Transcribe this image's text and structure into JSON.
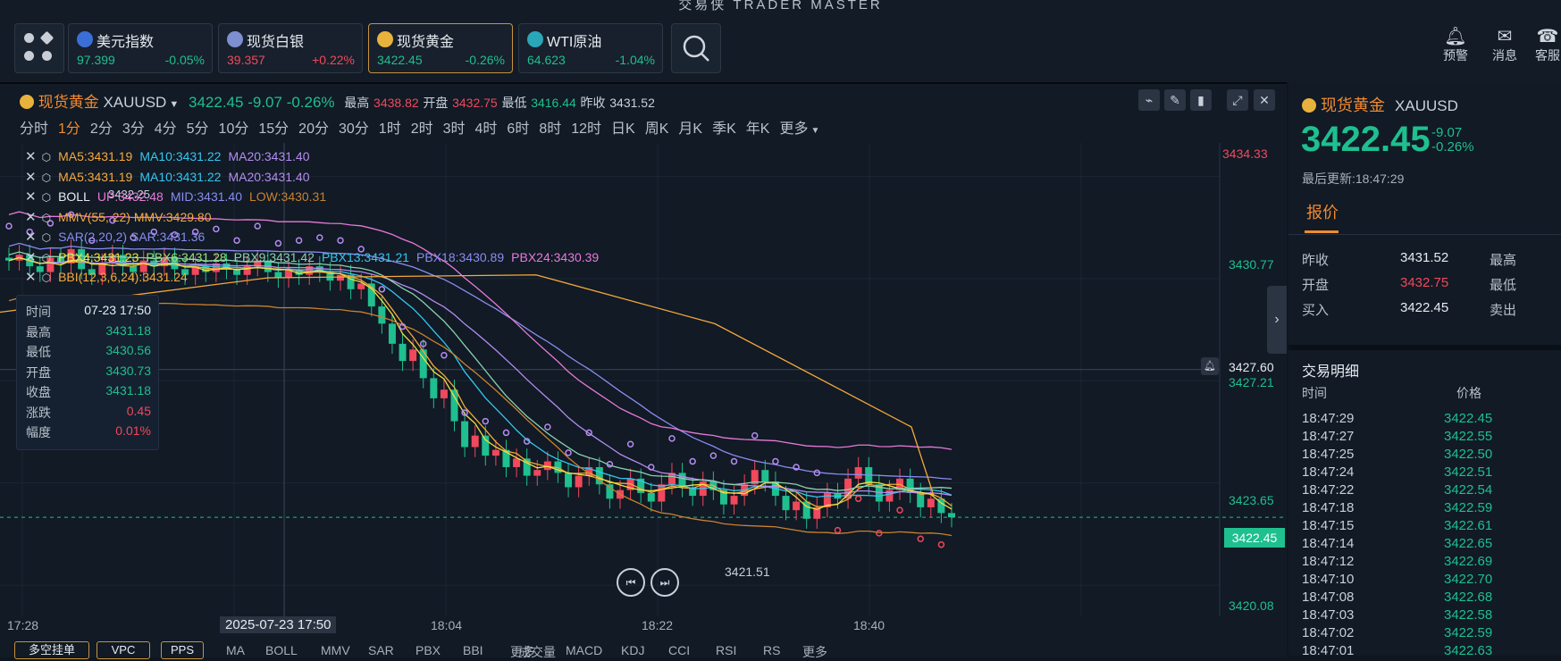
{
  "app_title": "交易侠 TRADER MASTER",
  "tickers": [
    {
      "name": "美元指数",
      "price": "97.399",
      "change": "-0.05%",
      "price_dir": "down",
      "change_dir": "down",
      "icon_color": "#3b6fd8"
    },
    {
      "name": "现货白银",
      "price": "39.357",
      "change": "+0.22%",
      "price_dir": "up",
      "change_dir": "up",
      "icon_color": "#7d8fd0"
    },
    {
      "name": "现货黄金",
      "price": "3422.45",
      "change": "-0.26%",
      "price_dir": "down",
      "change_dir": "down",
      "icon_color": "#e8b23c"
    },
    {
      "name": "WTI原油",
      "price": "64.623",
      "change": "-1.04%",
      "price_dir": "down",
      "change_dir": "down",
      "icon_color": "#2aa6b8"
    }
  ],
  "top_buttons": [
    {
      "label": "预警",
      "icon": "bell-icon"
    },
    {
      "label": "消息",
      "icon": "mail-icon"
    },
    {
      "label": "客服",
      "icon": "headset-icon"
    }
  ],
  "chart_header": {
    "name": "现货黄金",
    "symbol": "XAUUSD",
    "price": "3422.45",
    "change": "-9.07",
    "change_pct": "-0.26%",
    "high_label": "最高",
    "high": "3438.82",
    "open_label": "开盘",
    "open": "3432.75",
    "low_label": "最低",
    "low": "3416.44",
    "prev_label": "昨收",
    "prev": "3431.52"
  },
  "timeframes": [
    "分时",
    "1分",
    "2分",
    "3分",
    "4分",
    "5分",
    "10分",
    "15分",
    "20分",
    "30分",
    "1时",
    "2时",
    "3时",
    "4时",
    "6时",
    "8时",
    "12时",
    "日K",
    "周K",
    "月K",
    "季K",
    "年K",
    "更多"
  ],
  "selected_timeframe": "1分",
  "indicators": [
    {
      "parts": [
        {
          "t": "MA5:3431.19",
          "c": "#f7a93a"
        },
        {
          "t": "MA10:3431.22",
          "c": "#35c6f0"
        },
        {
          "t": "MA20:3431.40",
          "c": "#b58cf0"
        }
      ]
    },
    {
      "parts": [
        {
          "t": "MA5:3431.19",
          "c": "#f7a93a"
        },
        {
          "t": "MA10:3431.22",
          "c": "#35c6f0"
        },
        {
          "t": "MA20:3431.40",
          "c": "#b58cf0"
        }
      ]
    },
    {
      "parts": [
        {
          "t": "BOLL",
          "c": "#e6ebf0"
        },
        {
          "t": "UP:3432.48",
          "c": "#e879d8"
        },
        {
          "t": "MID:3431.40",
          "c": "#8a8cf0"
        },
        {
          "t": "LOW:3430.31",
          "c": "#c9812f"
        }
      ]
    },
    {
      "parts": [
        {
          "t": "MMV(55, 22) MMV:3429.80",
          "c": "#f7a93a"
        }
      ]
    },
    {
      "parts": [
        {
          "t": "SAR(2,20,2) SAR:3431.36",
          "c": "#8a8cf0"
        }
      ]
    },
    {
      "parts": [
        {
          "t": "PBX4:3431.23",
          "c": "#f0e040"
        },
        {
          "t": "PBX6:3431.28",
          "c": "#9be07a"
        },
        {
          "t": "PBX9:3431.42",
          "c": "#8ad0b0"
        },
        {
          "t": "PBX13:3431.21",
          "c": "#35c6f0"
        },
        {
          "t": "PBX18:3430.89",
          "c": "#8a8cf0"
        },
        {
          "t": "PBX24:3430.39",
          "c": "#e879d8"
        }
      ]
    },
    {
      "parts": [
        {
          "t": "BBI(12,3,6,24):3431.24",
          "c": "#f7a93a"
        }
      ]
    }
  ],
  "tooltip": [
    {
      "k": "时间",
      "v": "07-23 17:50",
      "c": "#e6ebf0"
    },
    {
      "k": "最高",
      "v": "3431.18",
      "c": "#1fbf8f"
    },
    {
      "k": "最低",
      "v": "3430.56",
      "c": "#1fbf8f"
    },
    {
      "k": "开盘",
      "v": "3430.73",
      "c": "#1fbf8f"
    },
    {
      "k": "收盘",
      "v": "3431.18",
      "c": "#1fbf8f"
    },
    {
      "k": "涨跌",
      "v": "0.45",
      "c": "#f0485c"
    },
    {
      "k": "幅度",
      "v": "0.01%",
      "c": "#f0485c"
    }
  ],
  "price_axis": [
    "3434.33",
    "3430.77",
    "3427.60",
    "3427.21",
    "3423.65",
    "3422.45",
    "3420.08"
  ],
  "time_axis": [
    "17:28",
    "2025-07-23 17:50",
    "18:04",
    "18:22",
    "18:40"
  ],
  "chart_annotation_low": "3421.51",
  "chart_annotation_mid": "3432.25",
  "chart_data": {
    "type": "candlestick",
    "ylim": [
      3419.0,
      3435.5
    ],
    "closes": [
      3431.4,
      3431.6,
      3431.2,
      3431.0,
      3431.5,
      3431.3,
      3431.8,
      3431.1,
      3430.9,
      3431.3,
      3431.6,
      3431.2,
      3431.0,
      3431.4,
      3431.2,
      3431.5,
      3431.1,
      3430.9,
      3431.2,
      3431.0,
      3431.3,
      3431.1,
      3430.9,
      3431.2,
      3431.4,
      3431.0,
      3430.8,
      3431.1,
      3430.9,
      3431.2,
      3431.0,
      3430.7,
      3430.9,
      3430.4,
      3430.6,
      3429.8,
      3429.2,
      3428.5,
      3427.9,
      3428.3,
      3427.3,
      3426.6,
      3426.9,
      3425.8,
      3424.9,
      3425.3,
      3424.6,
      3424.8,
      3424.2,
      3424.5,
      3423.9,
      3424.1,
      3424.4,
      3424.0,
      3423.5,
      3423.9,
      3424.2,
      3423.6,
      3423.1,
      3423.4,
      3423.8,
      3423.3,
      3423.0,
      3423.6,
      3424.0,
      3423.5,
      3423.2,
      3423.7,
      3423.4,
      3422.9,
      3423.2,
      3423.6,
      3424.1,
      3423.7,
      3423.2,
      3422.7,
      3423.0,
      3422.4,
      3422.8,
      3423.3,
      3423.1,
      3423.8,
      3424.2,
      3423.6,
      3423.0,
      3423.4,
      3423.8,
      3423.3,
      3422.8,
      3423.1,
      3422.6,
      3422.45
    ],
    "ma5_end": "3431.19",
    "bid_price": "3422.45"
  },
  "right_panel": {
    "name": "现货黄金",
    "symbol": "XAUUSD",
    "price": "3422.45",
    "change": "-9.07",
    "change_pct": "-0.26%",
    "updated": "最后更新:18:47:29",
    "tab": "报价",
    "quotes": [
      {
        "k": "昨收",
        "v": "3431.52",
        "c": "#e6ebf0",
        "k2": "最高"
      },
      {
        "k": "开盘",
        "v": "3432.75",
        "c": "#f0485c",
        "k2": "最低"
      },
      {
        "k": "买入",
        "v": "3422.45",
        "c": "#e6ebf0",
        "k2": "卖出"
      }
    ],
    "trades_title": "交易明细",
    "trades_head": [
      "时间",
      "价格"
    ],
    "trades": [
      [
        "18:47:29",
        "3422.45"
      ],
      [
        "18:47:27",
        "3422.55"
      ],
      [
        "18:47:25",
        "3422.50"
      ],
      [
        "18:47:24",
        "3422.51"
      ],
      [
        "18:47:22",
        "3422.54"
      ],
      [
        "18:47:18",
        "3422.59"
      ],
      [
        "18:47:15",
        "3422.61"
      ],
      [
        "18:47:14",
        "3422.65"
      ],
      [
        "18:47:12",
        "3422.69"
      ],
      [
        "18:47:10",
        "3422.70"
      ],
      [
        "18:47:08",
        "3422.68"
      ],
      [
        "18:47:03",
        "3422.58"
      ],
      [
        "18:47:02",
        "3422.59"
      ],
      [
        "18:47:01",
        "3422.63"
      ]
    ]
  },
  "bottom_buttons": [
    "多空挂单",
    "VPC",
    "PPS"
  ],
  "bottom_tabs_main": [
    "MA",
    "BOLL",
    "MMV",
    "SAR",
    "PBX",
    "BBI",
    "更多"
  ],
  "bottom_tabs_sub": [
    "成交量",
    "MACD",
    "KDJ",
    "CCI",
    "RSI",
    "RS",
    "更多"
  ],
  "colors": {
    "up": "#f0485c",
    "down": "#1fbf8f",
    "accent": "#f28a2e"
  }
}
